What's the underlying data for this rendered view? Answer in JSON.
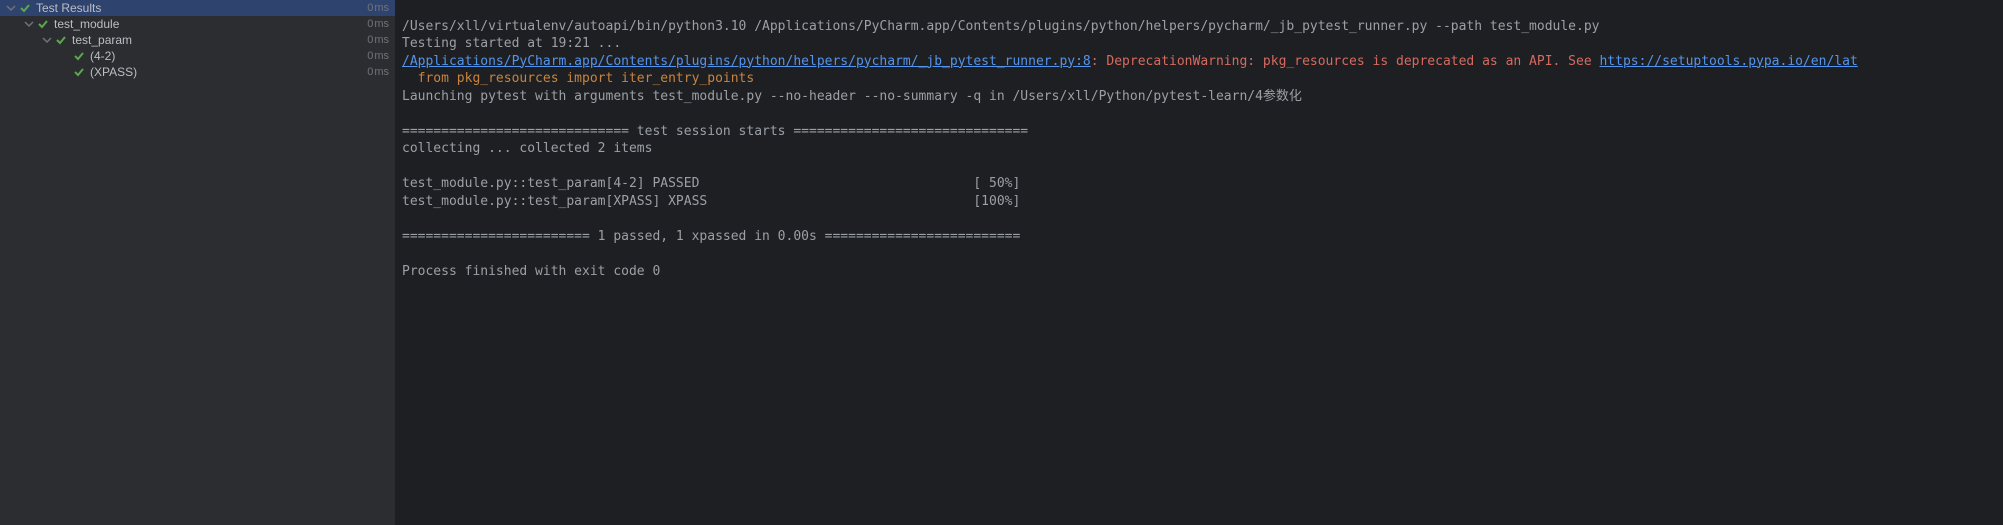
{
  "tree": {
    "root": {
      "label": "Test Results",
      "time": "0",
      "unit": "ms",
      "indent": 4
    },
    "module": {
      "label": "test_module",
      "time": "0",
      "unit": "ms",
      "indent": 22
    },
    "param": {
      "label": "test_param",
      "time": "0",
      "unit": "ms",
      "indent": 40
    },
    "case1": {
      "label": "(4-2)",
      "time": "0",
      "unit": "ms",
      "indent": 58
    },
    "case2": {
      "label": "(XPASS)",
      "time": "0",
      "unit": "ms",
      "indent": 58
    }
  },
  "console": {
    "cmd": "/Users/xll/virtualenv/autoapi/bin/python3.10 /Applications/PyCharm.app/Contents/plugins/python/helpers/pycharm/_jb_pytest_runner.py --path test_module.py",
    "started": "Testing started at 19:21 ...",
    "link_file": "/Applications/PyCharm.app/Contents/plugins/python/helpers/pycharm/_jb_pytest_runner.py:8",
    "deprec_head": ": DeprecationWarning: pkg_resources is deprecated as an API. See ",
    "link_url": "https://setuptools.pypa.io/en/lat",
    "deprec_body": "  from pkg_resources import iter_entry_points",
    "launching": "Launching pytest with arguments test_module.py --no-header --no-summary -q in /Users/xll/Python/pytest-learn/4参数化",
    "blank": "",
    "sess_start": "============================= test session starts ==============================",
    "collecting": "collecting ... collected 2 items",
    "item1": "test_module.py::test_param[4-2] PASSED                                   [ 50%]",
    "item2": "test_module.py::test_param[XPASS] XPASS                                  [100%]",
    "summary": "======================== 1 passed, 1 xpassed in 0.00s =========================",
    "exit": "Process finished with exit code 0"
  }
}
